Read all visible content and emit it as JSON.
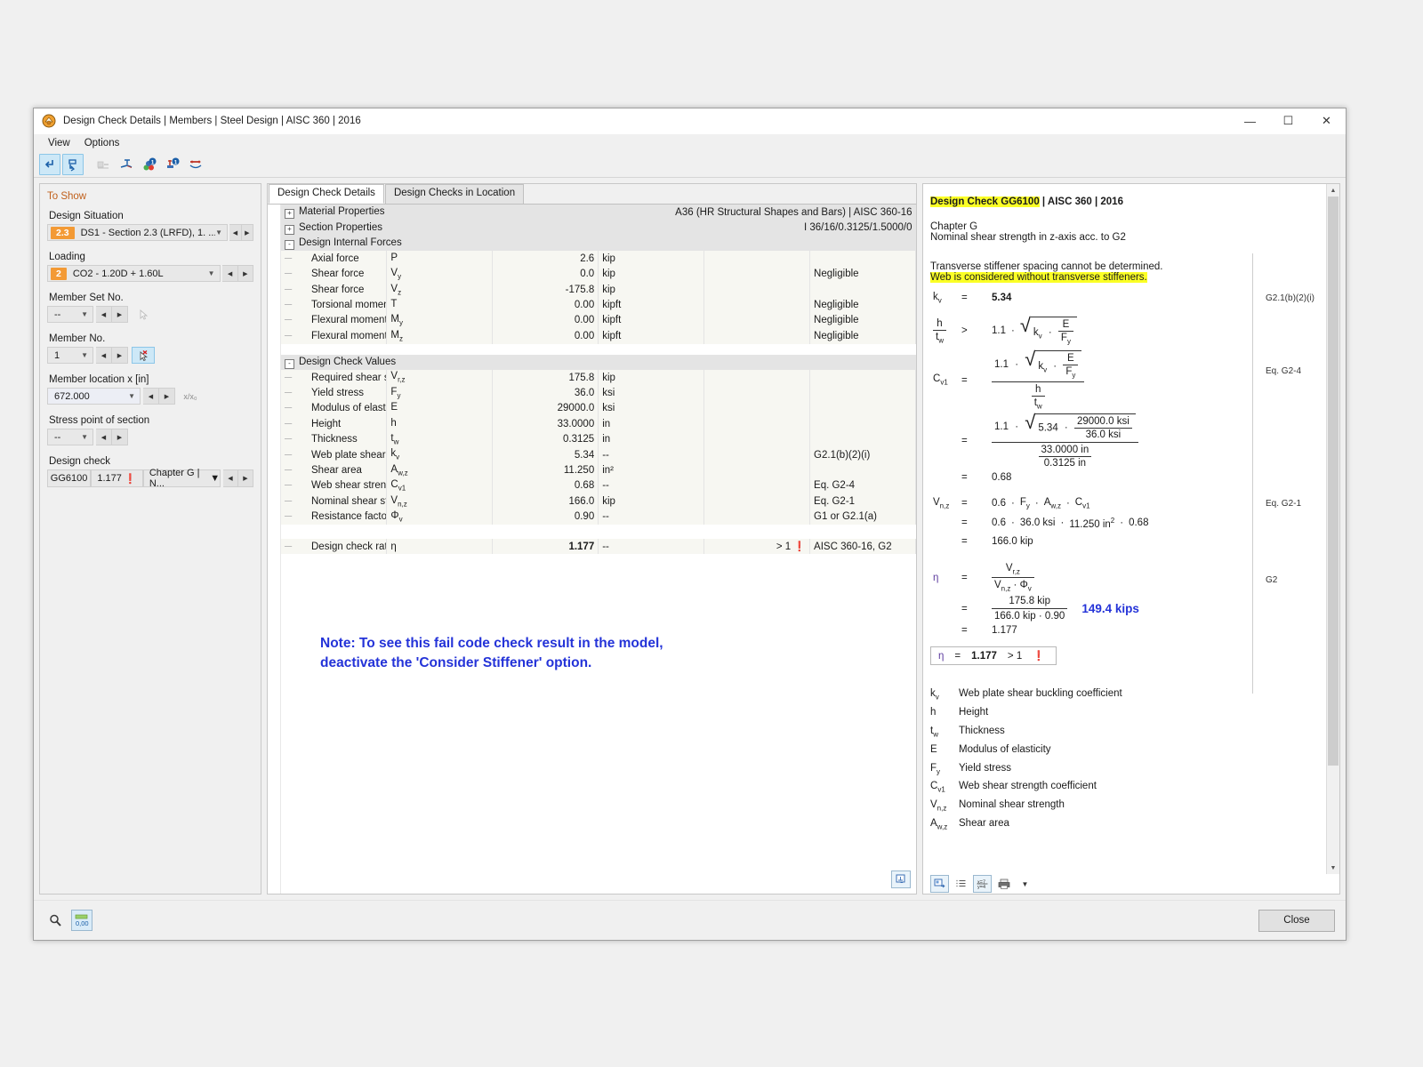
{
  "window": {
    "title": "Design Check Details | Members | Steel Design | AISC 360 | 2016",
    "minimize": "—",
    "maximize": "☐",
    "close": "✕"
  },
  "menu": {
    "items": [
      "View",
      "Options"
    ]
  },
  "toolbar": {
    "buttons": [
      {
        "name": "undo-icon",
        "label": "↶"
      },
      {
        "name": "redo-icon",
        "label": "↷"
      },
      {
        "name": "section-view-icon",
        "label": "▤"
      },
      {
        "name": "stress-point-icon",
        "label": "⊥"
      },
      {
        "name": "info-member-icon",
        "label": "ℹ"
      },
      {
        "name": "info-node-icon",
        "label": "ℹ"
      },
      {
        "name": "diagram-icon",
        "label": "⌒"
      }
    ]
  },
  "sidebar": {
    "header": "To Show",
    "design_situation": {
      "label": "Design Situation",
      "tag": "2.3",
      "value": "DS1 - Section 2.3 (LRFD), 1. ..."
    },
    "loading": {
      "label": "Loading",
      "tag": "2",
      "value": "CO2 - 1.20D + 1.60L"
    },
    "member_set_no": {
      "label": "Member Set No.",
      "value": "--"
    },
    "member_no": {
      "label": "Member No.",
      "value": "1"
    },
    "member_location": {
      "label": "Member location x [in]",
      "value": "672.000",
      "ratio_btn": "x/x₀"
    },
    "stress_point": {
      "label": "Stress point of section",
      "value": "--"
    },
    "design_check": {
      "label": "Design check",
      "code": "GG6100",
      "ratio": "1.177",
      "flag": "❗",
      "desc": "Chapter G | N..."
    }
  },
  "center": {
    "tabs": [
      {
        "label": "Design Check Details",
        "active": true
      },
      {
        "label": "Design Checks in Location",
        "active": false
      }
    ],
    "groups": [
      {
        "type": "group",
        "expander": "+",
        "name": "Material Properties",
        "right": "A36 (HR Structural Shapes and Bars) | AISC 360-16"
      },
      {
        "type": "group",
        "expander": "+",
        "name": "Section Properties",
        "right": "I 36/16/0.3125/1.5000/0"
      },
      {
        "type": "group",
        "expander": "-",
        "name": "Design Internal Forces",
        "right": ""
      }
    ],
    "internal_forces": [
      {
        "name": "Axial force",
        "sym": "P",
        "sub": "",
        "val": "2.6",
        "unit": "kip",
        "note": "",
        "ref": ""
      },
      {
        "name": "Shear force",
        "sym": "V",
        "sub": "y",
        "val": "0.0",
        "unit": "kip",
        "note": "",
        "ref": "Negligible"
      },
      {
        "name": "Shear force",
        "sym": "V",
        "sub": "z",
        "val": "-175.8",
        "unit": "kip",
        "note": "",
        "ref": ""
      },
      {
        "name": "Torsional moment",
        "sym": "T",
        "sub": "",
        "val": "0.00",
        "unit": "kipft",
        "note": "",
        "ref": "Negligible"
      },
      {
        "name": "Flexural moment",
        "sym": "M",
        "sub": "y",
        "val": "0.00",
        "unit": "kipft",
        "note": "",
        "ref": "Negligible"
      },
      {
        "name": "Flexural moment",
        "sym": "M",
        "sub": "z",
        "val": "0.00",
        "unit": "kipft",
        "note": "",
        "ref": "Negligible"
      }
    ],
    "design_check_values_group": {
      "expander": "-",
      "name": "Design Check Values"
    },
    "design_check_values": [
      {
        "name": "Required shear strength",
        "sym": "V",
        "sub": "r,z",
        "val": "175.8",
        "unit": "kip",
        "ref": ""
      },
      {
        "name": "Yield stress",
        "sym": "F",
        "sub": "y",
        "val": "36.0",
        "unit": "ksi",
        "ref": ""
      },
      {
        "name": "Modulus of elasticity",
        "sym": "E",
        "sub": "",
        "val": "29000.0",
        "unit": "ksi",
        "ref": ""
      },
      {
        "name": "Height",
        "sym": "h",
        "sub": "",
        "val": "33.0000",
        "unit": "in",
        "ref": ""
      },
      {
        "name": "Thickness",
        "sym": "t",
        "sub": "w",
        "val": "0.3125",
        "unit": "in",
        "ref": ""
      },
      {
        "name": "Web plate shear buckling coefficient",
        "sym": "k",
        "sub": "v",
        "val": "5.34",
        "unit": "--",
        "ref": "G2.1(b)(2)(i)"
      },
      {
        "name": "Shear area",
        "sym": "A",
        "sub": "w,z",
        "val": "11.250",
        "unit": "in²",
        "ref": ""
      },
      {
        "name": "Web shear strength coefficient",
        "sym": "C",
        "sub": "v1",
        "val": "0.68",
        "unit": "--",
        "ref": "Eq. G2-4"
      },
      {
        "name": "Nominal shear strength",
        "sym": "V",
        "sub": "n,z",
        "val": "166.0",
        "unit": "kip",
        "ref": "Eq. G2-1"
      },
      {
        "name": "Resistance factor for shear",
        "sym": "Φ",
        "sub": "v",
        "val": "0.90",
        "unit": "--",
        "ref": "G1 or G2.1(a)"
      }
    ],
    "ratio_row": {
      "name": "Design check ratio",
      "sym": "η",
      "val": "1.177",
      "unit": "--",
      "note": "> 1",
      "flag": "❗",
      "ref": "AISC 360-16, G2"
    },
    "note": "Note: To see this fail code check result in the model, deactivate the 'Consider Stiffener' option.",
    "note_line1": "Note: To see this fail code check result in the model,",
    "note_line2": "deactivate the 'Consider Stiffener' option.",
    "note_color": "#2433d8"
  },
  "report": {
    "title_highlight": "Design Check GG6100",
    "title_rest": " | AISC 360 | 2016",
    "chapter": "Chapter G",
    "subtitle": "Nominal shear strength in z-axis acc. to G2",
    "msg1": "Transverse stiffener spacing cannot be determined.",
    "msg2": "Web is considered without transverse stiffeners.",
    "kv_label": "k",
    "kv_sub": "v",
    "kv_eq": "=",
    "kv_value": "5.34",
    "ref_kv": "G2.1(b)(2)(i)",
    "ref_g24": "Eq. G2-4",
    "ref_g21": "Eq. G2-1",
    "ref_g2": "G2",
    "cond_factor": "1.1",
    "cv1_label": "C",
    "cv1_sub": "v1",
    "cv1_result": "0.68",
    "E_value": "29000.0 ksi",
    "Fy_value": "36.0 ksi",
    "h_value": "33.0000 in",
    "tw_value": "0.3125 in",
    "kv_num": "5.34",
    "vnz_formula_c": "0.6",
    "vnz_num_fy": "36.0 ksi",
    "vnz_num_aw": "11.250 in",
    "vnz_num_aw_exp": "2",
    "vnz_num_cv1": "0.68",
    "vnz_result": "166.0 kip",
    "eta_sym": "η",
    "eta_num": "175.8 kip",
    "eta_den_vn": "166.0 kip",
    "eta_den_phi": "0.90",
    "eta_result": "1.177",
    "annotation": "149.4 kips",
    "annotation_color": "#2433d8",
    "result_eta": "η",
    "result_eq": "=",
    "result_value": "1.177",
    "result_cmp": "> 1",
    "result_flag": "❗",
    "legend": [
      {
        "sym": "k",
        "sub": "v",
        "desc": "Web plate shear buckling coefficient"
      },
      {
        "sym": "h",
        "sub": "",
        "desc": "Height"
      },
      {
        "sym": "t",
        "sub": "w",
        "desc": "Thickness"
      },
      {
        "sym": "E",
        "sub": "",
        "desc": "Modulus of elasticity"
      },
      {
        "sym": "F",
        "sub": "y",
        "desc": "Yield stress"
      },
      {
        "sym": "C",
        "sub": "v1",
        "desc": "Web shear strength coefficient"
      },
      {
        "sym": "V",
        "sub": "n,z",
        "desc": "Nominal shear strength"
      },
      {
        "sym": "A",
        "sub": "w,z",
        "desc": "Shear area"
      }
    ],
    "toolbar": [
      {
        "name": "copy-image-icon",
        "label": "⧉",
        "on": true
      },
      {
        "name": "list-icon",
        "label": "≣",
        "on": false
      },
      {
        "name": "formula-values-icon",
        "label": "±",
        "on": true
      },
      {
        "name": "print-icon",
        "label": "⎙",
        "on": false
      },
      {
        "name": "print-dropdown-icon",
        "label": "▾",
        "on": false
      }
    ]
  },
  "statusbar": {
    "buttons": [
      {
        "name": "select-tool-icon",
        "label": "⌕",
        "on": true
      },
      {
        "name": "numeric-values-icon",
        "label": "0,00",
        "on": true
      }
    ],
    "close_label": "Close"
  },
  "colors": {
    "accent_orange": "#f39a35",
    "highlight_yellow": "#fbff26",
    "note_blue": "#2433d8",
    "error_red": "#d81b1b",
    "header_label": "#c0601c"
  }
}
